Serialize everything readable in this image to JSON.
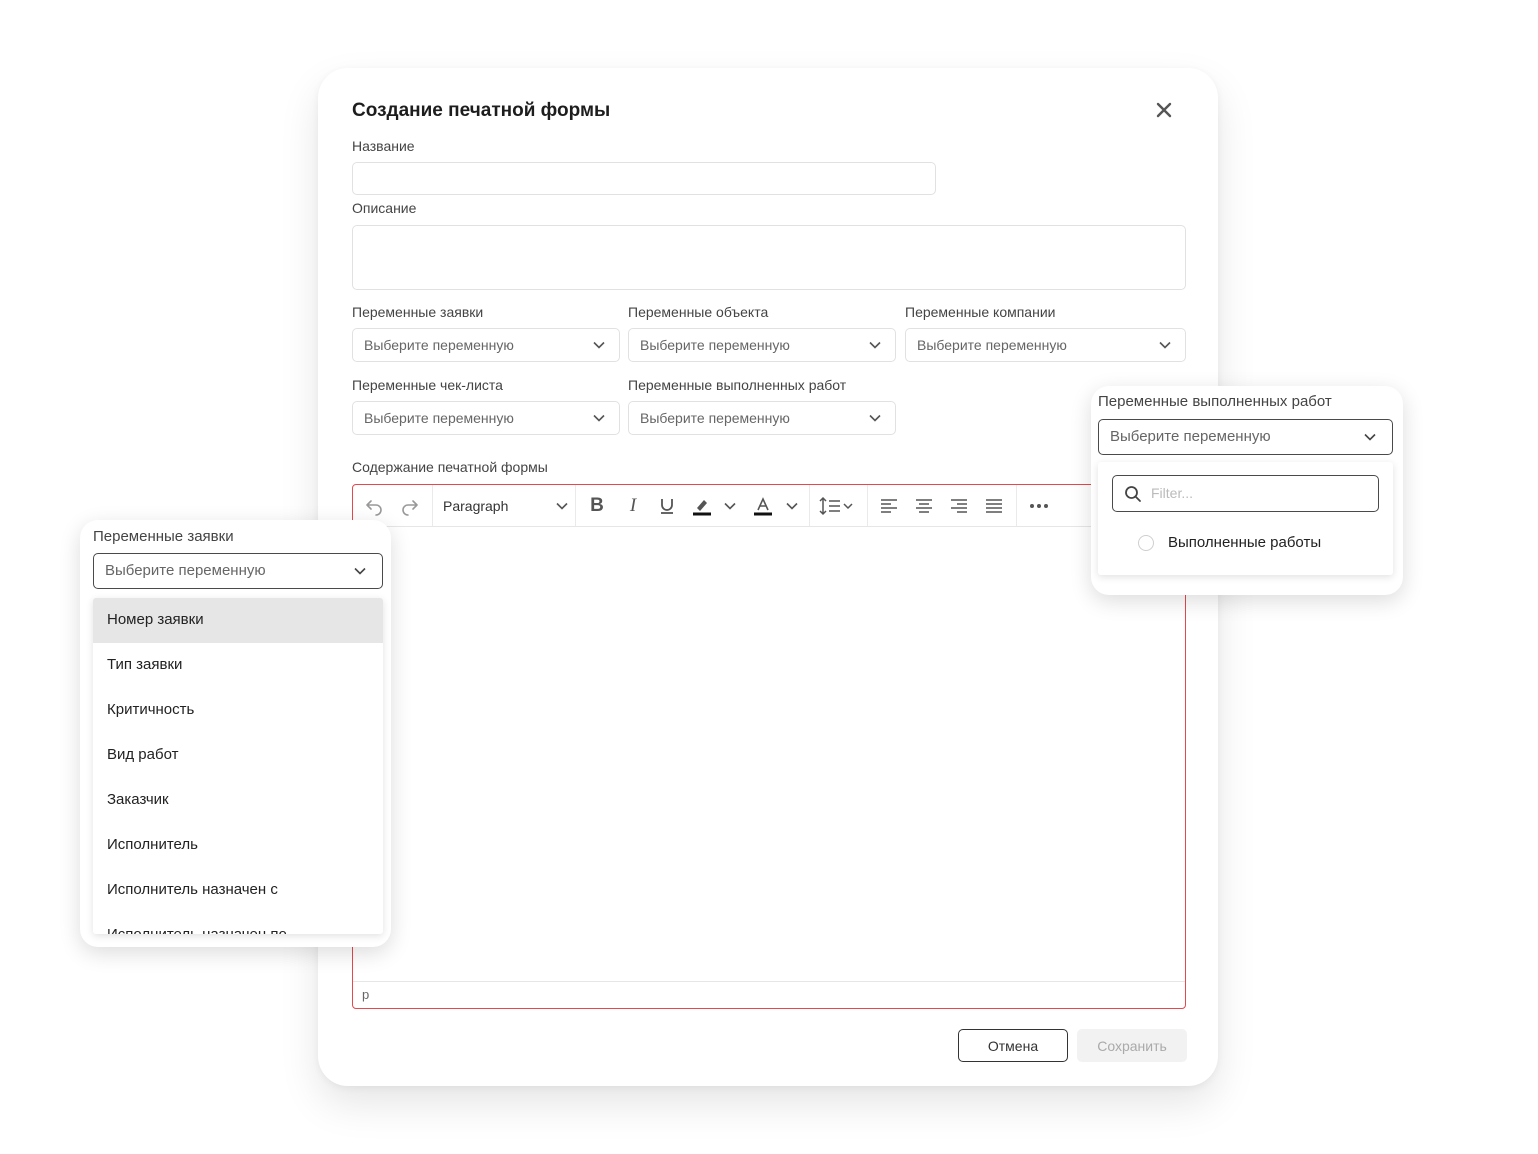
{
  "modal": {
    "title": "Создание печатной формы",
    "name_label": "Название",
    "name_value": "",
    "description_label": "Описание",
    "description_value": "",
    "variables": [
      {
        "label": "Переменные заявки",
        "placeholder": "Выберите переменную"
      },
      {
        "label": "Переменные объекта",
        "placeholder": "Выберите переменную"
      },
      {
        "label": "Переменные компании",
        "placeholder": "Выберите переменную"
      },
      {
        "label": "Переменные чек-листа",
        "placeholder": "Выберите переменную"
      },
      {
        "label": "Переменные выполненных работ",
        "placeholder": "Выберите переменную"
      }
    ],
    "content_label": "Содержание печатной формы",
    "editor": {
      "block_format": "Paragraph",
      "status_path": "p",
      "tools": [
        "undo-icon",
        "redo-icon",
        "bold-icon",
        "italic-icon",
        "underline-icon",
        "highlight-icon",
        "text-color-icon",
        "line-height-icon",
        "align-left-icon",
        "align-center-icon",
        "align-right-icon",
        "align-justify-icon",
        "more-icon"
      ]
    },
    "cancel_label": "Отмена",
    "save_label": "Сохранить",
    "accent_color": "#e5484d"
  },
  "left_card": {
    "label": "Переменные заявки",
    "placeholder": "Выберите переменную",
    "items": [
      "Номер заявки",
      "Тип заявки",
      "Критичность",
      "Вид работ",
      "Заказчик",
      "Исполнитель",
      "Исполнитель назначен с",
      "Исполнитель назначен по"
    ]
  },
  "right_card": {
    "label": "Переменные выполненных работ",
    "placeholder": "Выберите переменную",
    "filter_placeholder": "Filter...",
    "options": [
      "Выполненные работы"
    ]
  }
}
